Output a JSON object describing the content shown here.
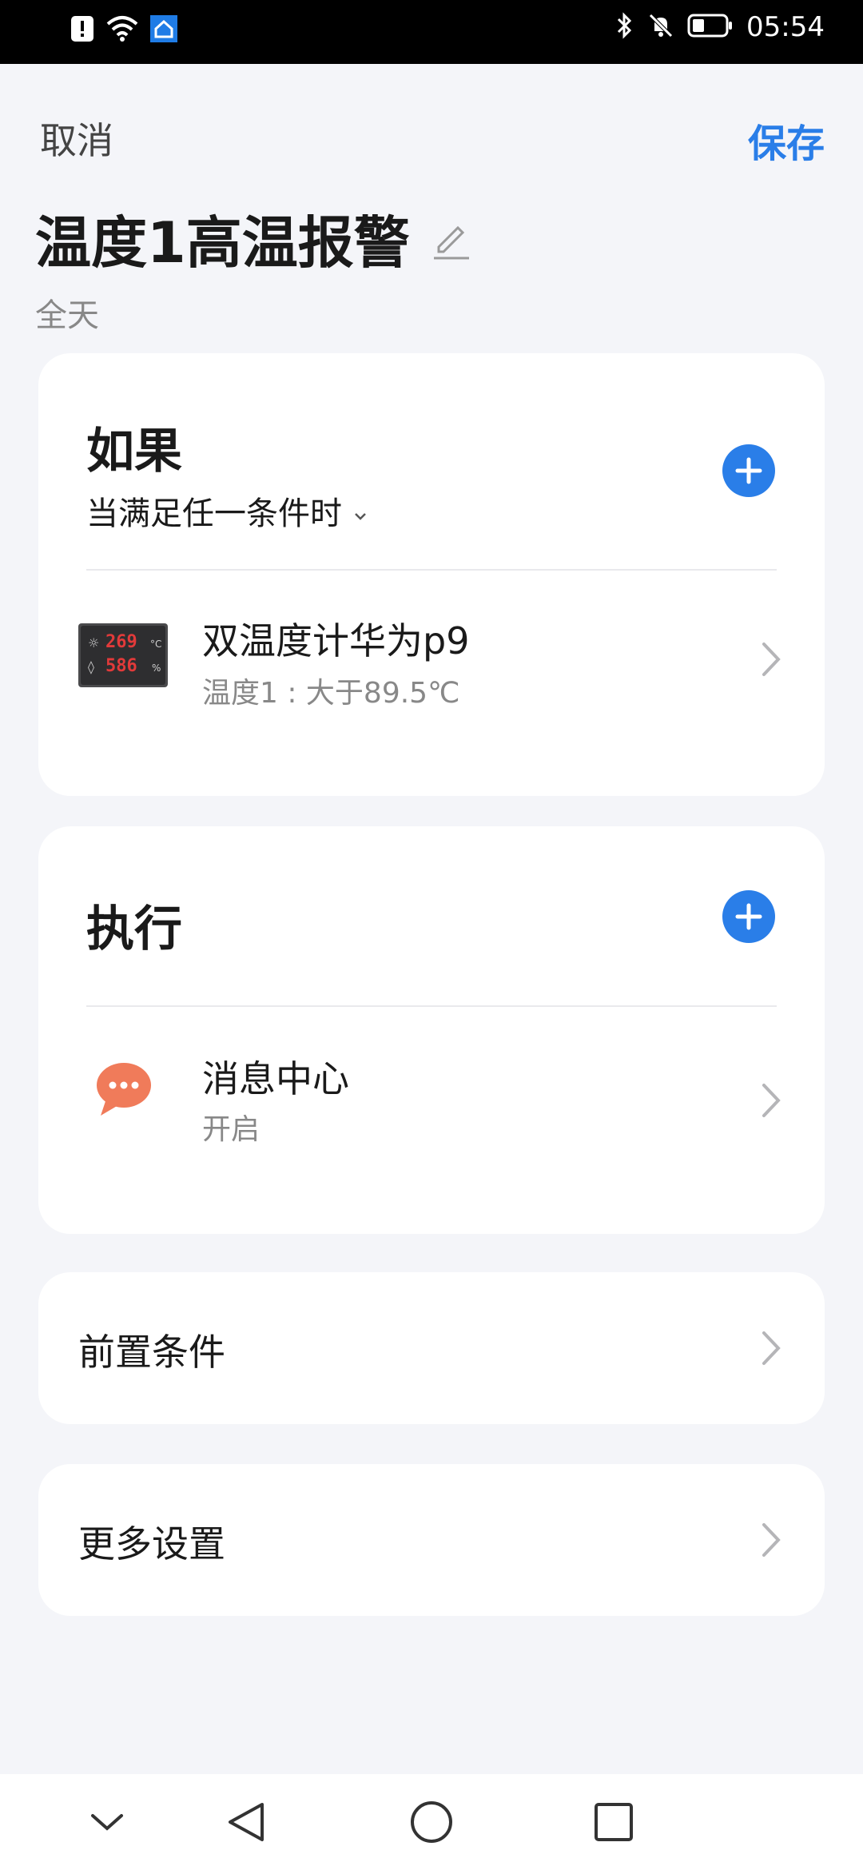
{
  "status_bar": {
    "time": "05:54",
    "left_icons": [
      "alert-icon",
      "wifi-icon",
      "smart-home-icon"
    ],
    "right_icons": [
      "bluetooth-icon",
      "mute-icon",
      "battery-icon"
    ]
  },
  "header": {
    "cancel_label": "取消",
    "save_label": "保存",
    "title": "温度1高温报警",
    "subtitle": "全天",
    "accent_color": "#2a7ee8"
  },
  "if_card": {
    "heading": "如果",
    "mode": "当满足任一条件时",
    "conditions": [
      {
        "icon": "thermometer-device-icon",
        "title": "双温度计华为p9",
        "subtitle": "温度1 : 大于89.5℃"
      }
    ]
  },
  "do_card": {
    "heading": "执行",
    "actions": [
      {
        "icon": "message-bubble-icon",
        "title": "消息中心",
        "subtitle": "开启"
      }
    ]
  },
  "precondition": {
    "label": "前置条件"
  },
  "more_settings": {
    "label": "更多设置"
  },
  "nav_bar": {
    "buttons": [
      "collapse-icon",
      "back-icon",
      "home-icon",
      "recents-icon"
    ]
  }
}
